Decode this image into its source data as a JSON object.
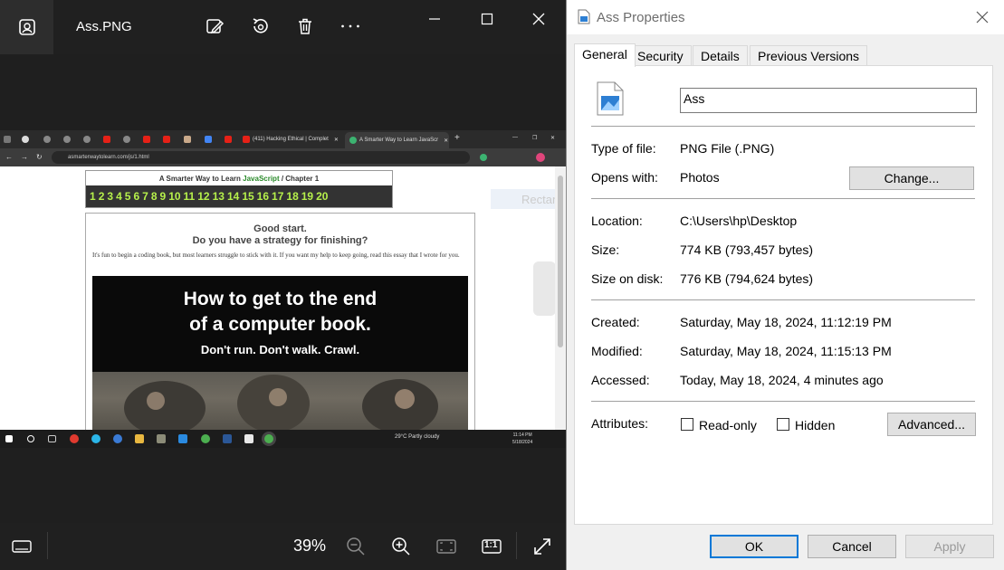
{
  "viewer": {
    "file_name": "Ass.PNG",
    "zoom": "39%",
    "icons": {
      "app": "photos-app-icon",
      "edit": "edit-image-icon",
      "rotate": "rotate-icon",
      "delete": "trash-icon",
      "more": "more-icon",
      "filmstrip": "filmstrip-icon",
      "zoom_out": "zoom-out-icon",
      "zoom_in": "zoom-in-icon",
      "fit": "fit-to-window-icon",
      "actual_size": "actual-size-icon",
      "fullscreen": "fullscreen-icon"
    },
    "actual_size_label": "1:1",
    "screenshot": {
      "tab_youtube": "(411) Hacking Ethical | Complet",
      "tab_active": "A Smarter Way to Learn JavaScr",
      "url": "asmarterwaytolearn.com/js/1.html",
      "header_prefix": "A Smarter Way to Learn ",
      "header_js": "JavaScript",
      "header_suffix": "  /  Chapter 1",
      "chapters": [
        "1",
        "2",
        "3",
        "4",
        "5",
        "6",
        "7",
        "8",
        "9",
        "10",
        "11",
        "12",
        "13",
        "14",
        "15",
        "16",
        "17",
        "18",
        "19",
        "20"
      ],
      "good_start": "Good start.",
      "strategy": "Do you have a strategy for finishing?",
      "intro": "It's fun to begin a coding book, but most learners struggle to stick with it. If you want my help to keep going, read this essay that I wrote for you.",
      "banner_line1": "How to get to the end",
      "banner_line2": "of a computer book.",
      "banner_line3": "Don't run. Don't walk. Crawl.",
      "snip_label": "Rectangular Snip",
      "weather": "29°C  Partly cloudy",
      "time": "11:14 PM",
      "date": "5/18/2024"
    }
  },
  "properties": {
    "title": "Ass Properties",
    "tabs": [
      "General",
      "Security",
      "Details",
      "Previous Versions"
    ],
    "active_tab": "General",
    "name_value": "Ass",
    "type_label": "Type of file:",
    "type_value": "PNG File (.PNG)",
    "opens_label": "Opens with:",
    "opens_value": "Photos",
    "change_button": "Change...",
    "location_label": "Location:",
    "location_value": "C:\\Users\\hp\\Desktop",
    "size_label": "Size:",
    "size_value": "774 KB (793,457 bytes)",
    "size_on_disk_label": "Size on disk:",
    "size_on_disk_value": "776 KB (794,624 bytes)",
    "created_label": "Created:",
    "created_value": "Saturday, May 18, 2024, 11:12:19 PM",
    "modified_label": "Modified:",
    "modified_value": "Saturday, May 18, 2024, 11:15:13 PM",
    "accessed_label": "Accessed:",
    "accessed_value": "Today, May 18, 2024, 4 minutes ago",
    "attributes_label": "Attributes:",
    "readonly_label": "Read-only",
    "readonly_checked": false,
    "hidden_label": "Hidden",
    "hidden_checked": false,
    "advanced_button": "Advanced...",
    "ok_button": "OK",
    "cancel_button": "Cancel",
    "apply_button": "Apply",
    "apply_enabled": false
  },
  "colors": {
    "viewer_bg": "#1f1f1f",
    "dialog_bg": "#f0f0f0",
    "accent": "#0078d7",
    "chapter_green": "#b6f04b"
  }
}
